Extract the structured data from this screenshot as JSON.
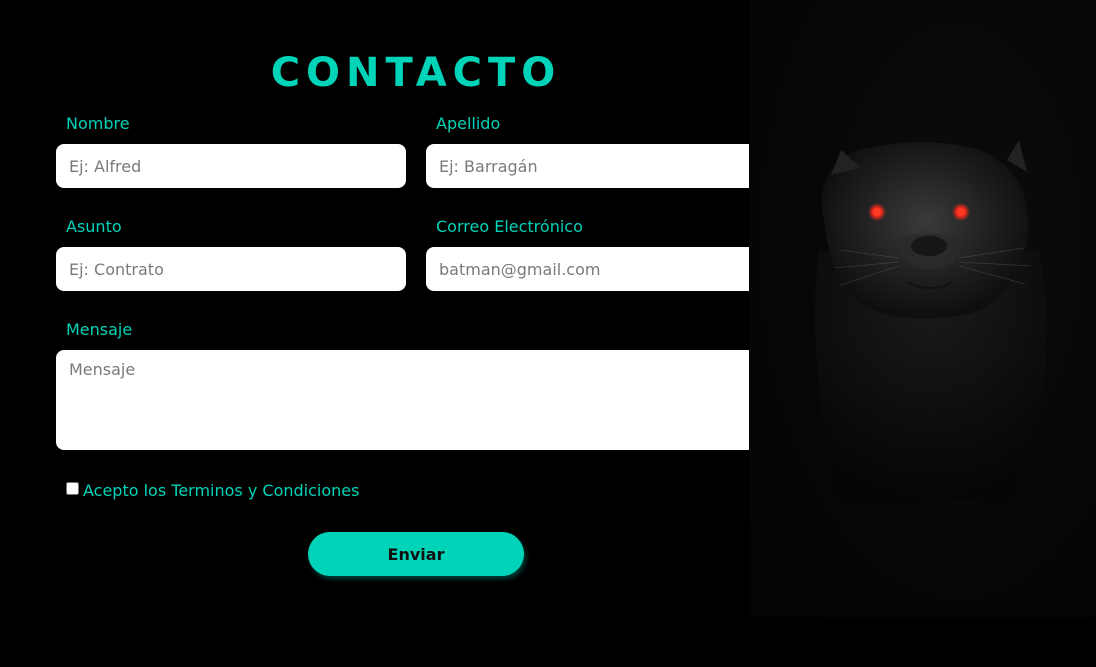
{
  "colors": {
    "accent": "#00d4b8",
    "background": "#000000",
    "eye": "#ff2a1a"
  },
  "form": {
    "title": "CONTACTO",
    "nombre": {
      "label": "Nombre",
      "placeholder": "Ej: Alfred"
    },
    "apellido": {
      "label": "Apellido",
      "placeholder": "Ej: Barragán"
    },
    "asunto": {
      "label": "Asunto",
      "placeholder": "Ej: Contrato"
    },
    "correo": {
      "label": "Correo Electrónico",
      "placeholder": "batman@gmail.com"
    },
    "mensaje": {
      "label": "Mensaje",
      "placeholder": "Mensaje"
    },
    "terms": {
      "label": "Acepto los Terminos y Condiciones",
      "checked": false
    },
    "submit_label": "Enviar"
  },
  "hero_image": {
    "icon": "black-panther-image"
  }
}
